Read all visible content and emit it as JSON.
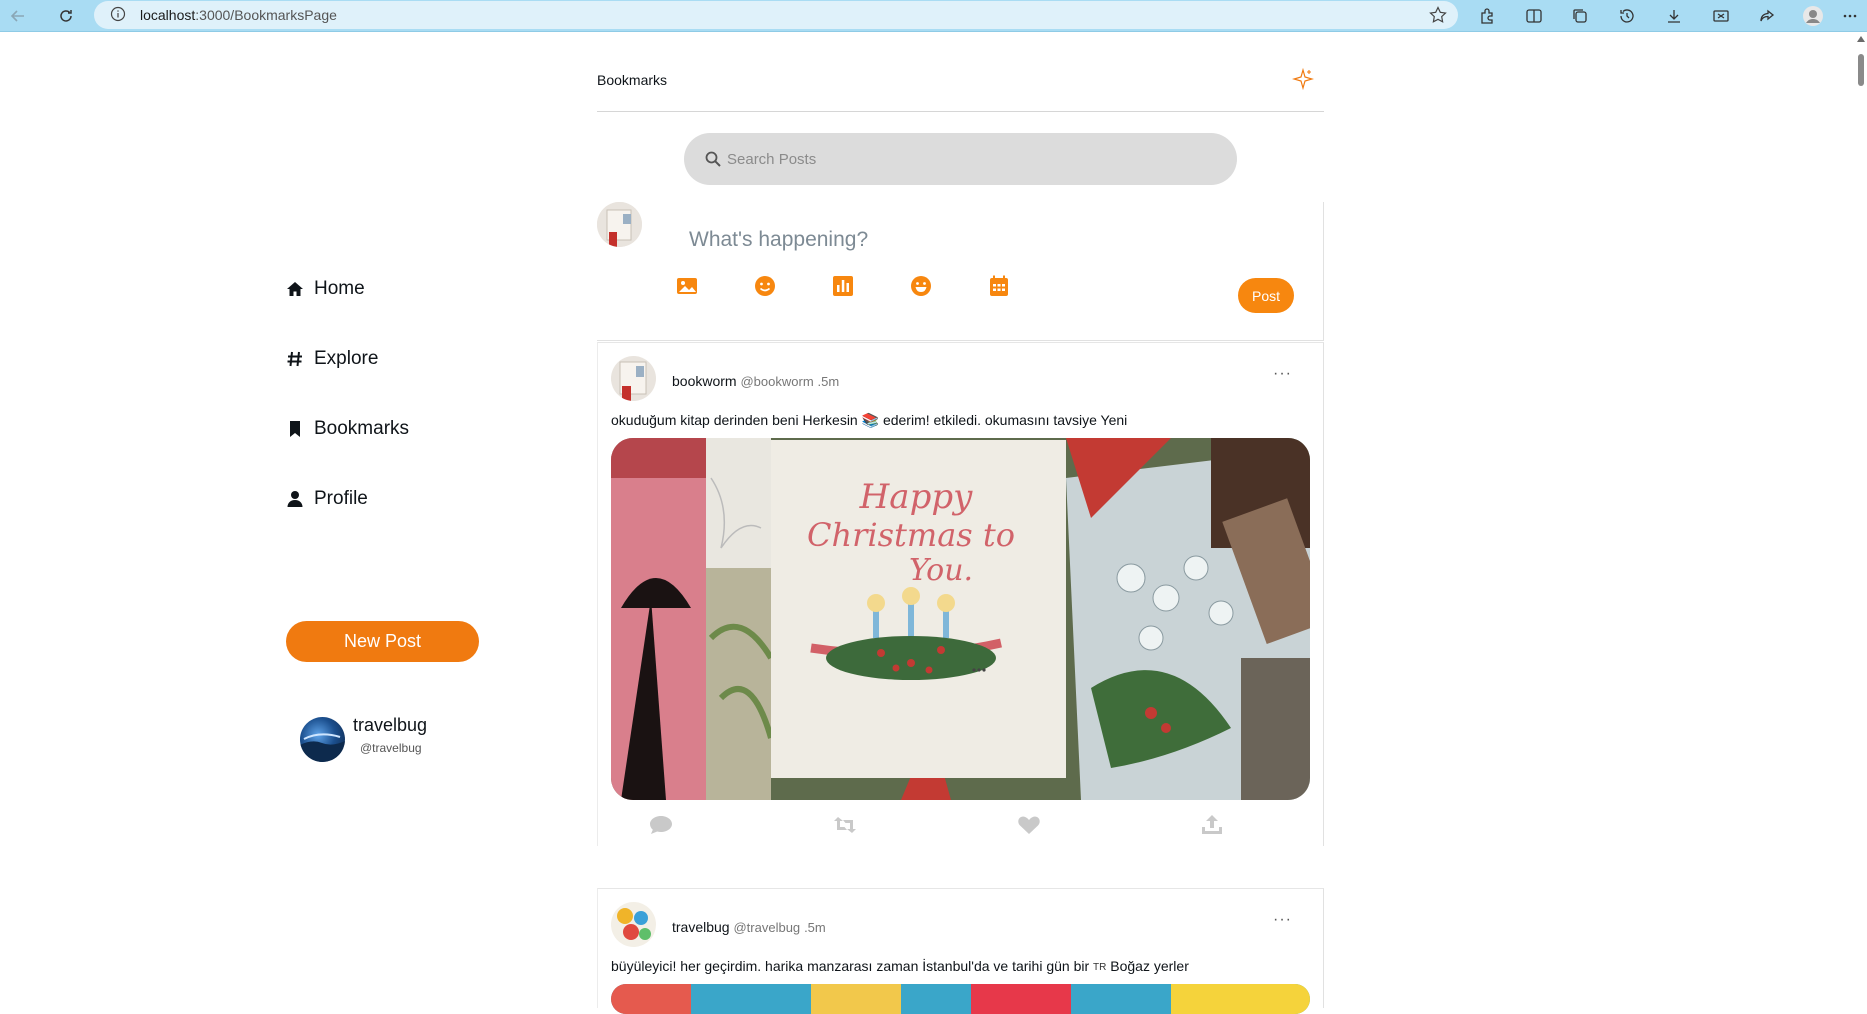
{
  "browser": {
    "url_host": "localhost",
    "url_path": ":3000/BookmarksPage"
  },
  "sidebar": {
    "items": [
      {
        "label": "Home",
        "icon": "home-icon"
      },
      {
        "label": "Explore",
        "icon": "hashtag-icon"
      },
      {
        "label": "Bookmarks",
        "icon": "bookmark-icon"
      },
      {
        "label": "Profile",
        "icon": "user-icon"
      }
    ],
    "new_post_label": "New Post",
    "user": {
      "name": "travelbug",
      "handle": "@travelbug"
    }
  },
  "header": {
    "title": "Bookmarks"
  },
  "search": {
    "placeholder": "Search Posts"
  },
  "composer": {
    "placeholder": "What's happening?",
    "post_label": "Post",
    "tools": [
      "image-icon",
      "emoji-icon",
      "poll-icon",
      "gif-emoji-icon",
      "schedule-calendar-icon"
    ]
  },
  "posts": [
    {
      "name": "bookworm",
      "handle": "@bookworm",
      "time": ".5m",
      "text_before": "okuduğum kitap derinden beni Herkesin",
      "emoji": "📚",
      "text_after": "ederim! etkiledi. okumasını tavsiye Yeni",
      "more": "···"
    },
    {
      "name": "travelbug",
      "handle": "@travelbug",
      "time": ".5m",
      "text_before": "büyüleyici! her geçirdim. harika manzarası zaman İstanbul'da ve tarihi gün bir",
      "flag": "TR",
      "text_after": "Boğaz yerler",
      "more": "···"
    }
  ],
  "colors": {
    "accent": "#f07a10",
    "post_button": "#f7870f",
    "browser_bar": "#a9dcf3",
    "search_bg": "#dcdcdc"
  }
}
